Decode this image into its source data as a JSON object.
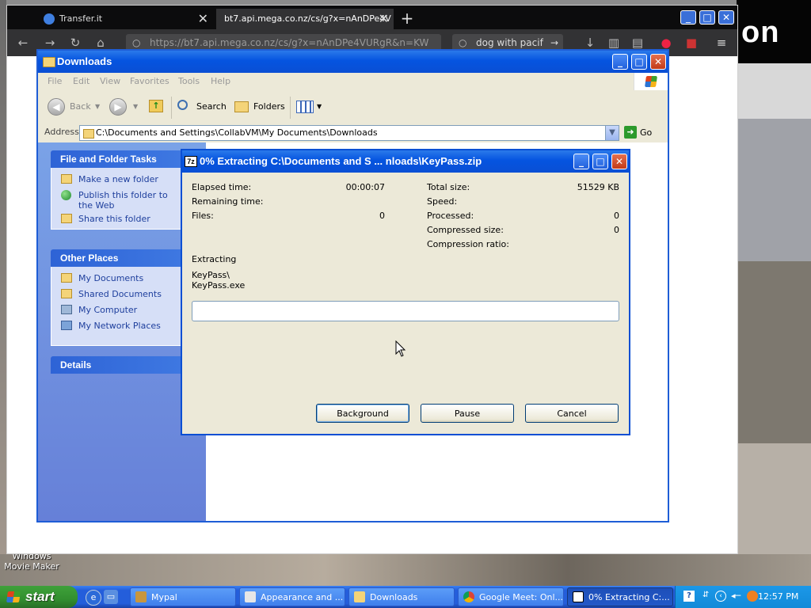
{
  "desktop": {
    "brand_fragment": "on",
    "icon_label": "Windows Movie Maker"
  },
  "browser": {
    "tabs": [
      {
        "label": "Transfer.it"
      },
      {
        "label": "bt7.api.mega.co.nz/cs/g?x=nAnDPe4V"
      }
    ],
    "url": "https://bt7.api.mega.co.nz/cs/g?x=nAnDPe4VURgR&n=KW",
    "search_text": "dog with pacif"
  },
  "explorer": {
    "title": "Downloads",
    "menu": [
      "File",
      "Edit",
      "View",
      "Favorites",
      "Tools",
      "Help"
    ],
    "toolbar": {
      "back": "Back",
      "search": "Search",
      "folders": "Folders"
    },
    "address_label": "Address",
    "address": "C:\\Documents and Settings\\CollabVM\\My Documents\\Downloads",
    "go": "Go",
    "panels": {
      "file_folder_tasks": {
        "title": "File and Folder Tasks",
        "items": [
          "Make a new folder",
          "Publish this folder to the Web",
          "Share this folder"
        ]
      },
      "other_places": {
        "title": "Other Places",
        "items": [
          "My Documents",
          "Shared Documents",
          "My Computer",
          "My Network Places"
        ]
      },
      "details": {
        "title": "Details"
      }
    }
  },
  "dialog": {
    "title": "0% Extracting C:\\Documents and S ... nloads\\KeyPass.zip",
    "left_stats": [
      {
        "label": "Elapsed time:",
        "value": "00:00:07"
      },
      {
        "label": "Remaining time:",
        "value": ""
      },
      {
        "label": "Files:",
        "value": "0"
      }
    ],
    "right_stats": [
      {
        "label": "Total size:",
        "value": "51529 KB"
      },
      {
        "label": "Speed:",
        "value": ""
      },
      {
        "label": "Processed:",
        "value": "0"
      },
      {
        "label": "Compressed size:",
        "value": "0"
      },
      {
        "label": "Compression ratio:",
        "value": ""
      }
    ],
    "status": "Extracting",
    "current_path_1": "KeyPass\\",
    "current_path_2": "KeyPass.exe",
    "progress_percent": 0,
    "buttons": {
      "background": "Background",
      "pause": "Pause",
      "cancel": "Cancel"
    }
  },
  "taskbar": {
    "start": "start",
    "tasks": [
      {
        "label": "Mypal"
      },
      {
        "label": "Appearance and ..."
      },
      {
        "label": "Downloads"
      },
      {
        "label": "Google Meet: Onl..."
      },
      {
        "label": "0% Extracting C:..."
      }
    ],
    "clock": "12:57 PM"
  },
  "colors": {
    "xp_title_blue": "#0554e0",
    "start_green": "#328f2f",
    "taskbar_blue": "#245edb",
    "dialog_face": "#ece9d8"
  }
}
